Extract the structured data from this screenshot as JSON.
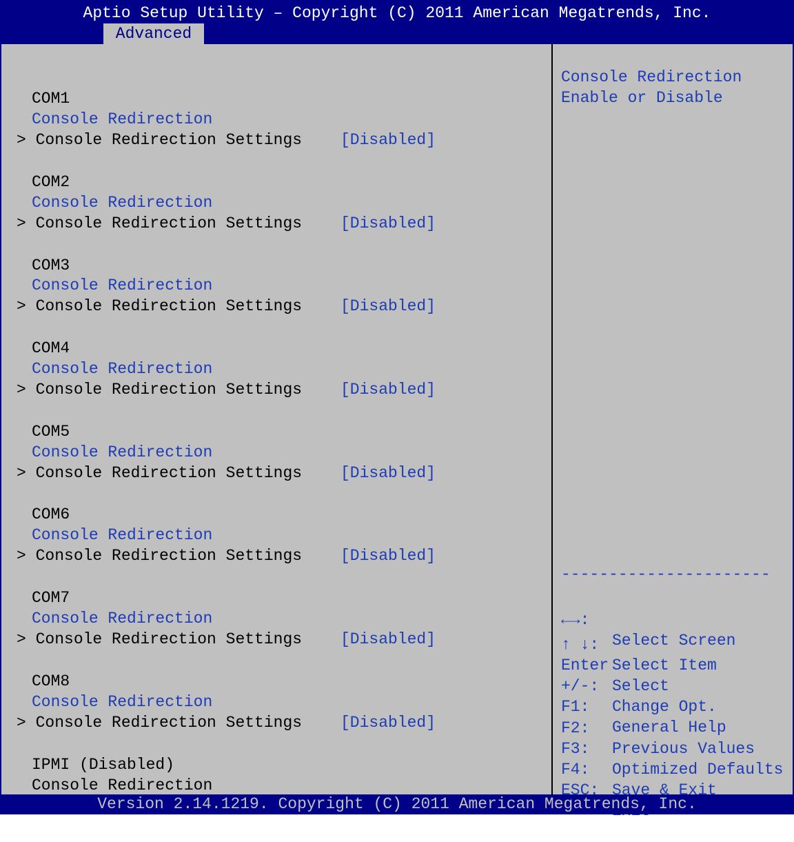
{
  "header": {
    "title": "Aptio Setup Utility – Copyright (C) 2011 American Megatrends, Inc.",
    "tab": "Advanced"
  },
  "ports": [
    {
      "label": "COM1",
      "option": "Console Redirection",
      "value": "[Disabled]",
      "submenu": "> Console Redirection Settings"
    },
    {
      "label": "COM2",
      "option": "Console Redirection",
      "value": "[Disabled]",
      "submenu": "> Console Redirection Settings"
    },
    {
      "label": "COM3",
      "option": "Console Redirection",
      "value": "[Disabled]",
      "submenu": "> Console Redirection Settings"
    },
    {
      "label": "COM4",
      "option": "Console Redirection",
      "value": "[Disabled]",
      "submenu": "> Console Redirection Settings"
    },
    {
      "label": "COM5",
      "option": "Console Redirection",
      "value": "[Disabled]",
      "submenu": "> Console Redirection Settings"
    },
    {
      "label": "COM6",
      "option": "Console Redirection",
      "value": "[Disabled]",
      "submenu": "> Console Redirection Settings"
    },
    {
      "label": "COM7",
      "option": "Console Redirection",
      "value": "[Disabled]",
      "submenu": "> Console Redirection Settings"
    },
    {
      "label": "COM8",
      "option": "Console Redirection",
      "value": "[Disabled]",
      "submenu": "> Console Redirection Settings"
    }
  ],
  "ipmi": {
    "label": "IPMI (Disabled)",
    "option": "Console Redirection"
  },
  "help": {
    "line1": "Console Redirection",
    "line2": "Enable or Disable",
    "separator": "----------------------"
  },
  "keys": [
    {
      "key": "←→:",
      "desc": "Select Screen"
    },
    {
      "key": "↑ ↓:",
      "desc": "Select Item"
    },
    {
      "key": "Enter",
      "desc": "Select"
    },
    {
      "key": "+/-:",
      "desc": "Change Opt."
    },
    {
      "key": "F1:",
      "desc": "General Help"
    },
    {
      "key": "F2:",
      "desc": "Previous Values"
    },
    {
      "key": "F3:",
      "desc": "Optimized Defaults"
    },
    {
      "key": "F4:",
      "desc": "Save & Exit"
    },
    {
      "key": "ESC:",
      "desc": "Exit"
    }
  ],
  "footer": {
    "text": "Version 2.14.1219. Copyright (C) 2011 American Megatrends, Inc."
  },
  "colors": {
    "frame": "#000088",
    "background": "#c0c0c0",
    "option_text": "#1e3cb4",
    "static_text": "#000000",
    "header_text": "#ffffff"
  }
}
